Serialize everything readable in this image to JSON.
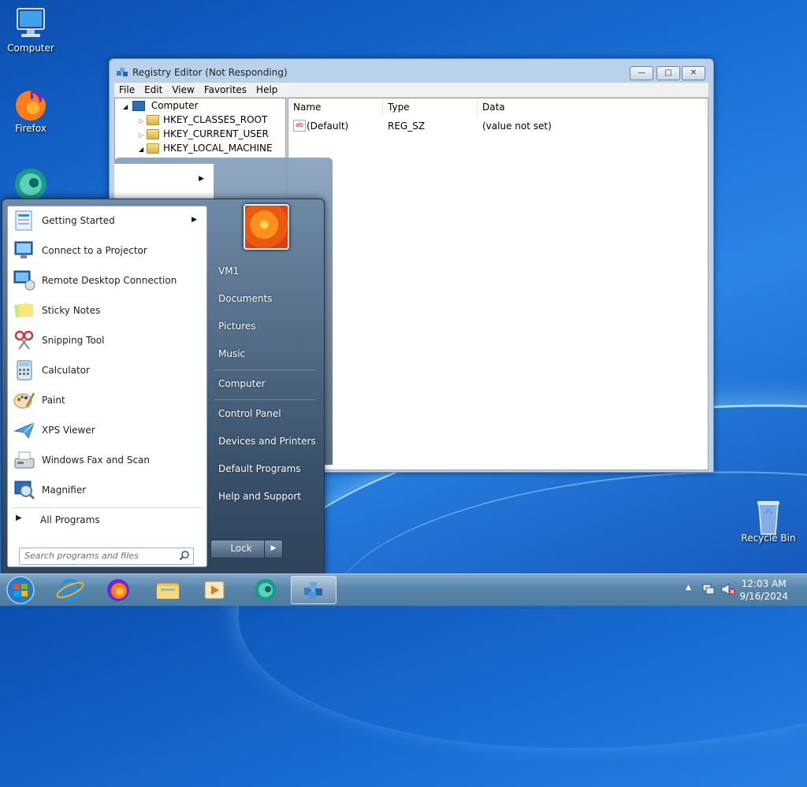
{
  "desktop": {
    "icons": [
      {
        "label": "Computer"
      },
      {
        "label": "Firefox"
      },
      {
        "label": "Recycle Bin"
      }
    ]
  },
  "registry": {
    "title": "Registry Editor (Not Responding)",
    "menu": [
      "File",
      "Edit",
      "View",
      "Favorites",
      "Help"
    ],
    "tree": [
      "Computer",
      "HKEY_CLASSES_ROOT",
      "HKEY_CURRENT_USER",
      "HKEY_LOCAL_MACHINE"
    ],
    "columns": [
      "Name",
      "Type",
      "Data"
    ],
    "rows": [
      {
        "name": "(Default)",
        "type": "REG_SZ",
        "data": "(value not set)"
      }
    ]
  },
  "start_menu": {
    "programs": [
      {
        "label": "Getting Started",
        "icon": "getting-started-icon"
      },
      {
        "label": "Connect to a Projector",
        "icon": "projector-icon"
      },
      {
        "label": "Remote Desktop Connection",
        "icon": "remote-desktop-icon"
      },
      {
        "label": "Sticky Notes",
        "icon": "sticky-notes-icon"
      },
      {
        "label": "Snipping Tool",
        "icon": "snipping-tool-icon"
      },
      {
        "label": "Calculator",
        "icon": "calculator-icon"
      },
      {
        "label": "Paint",
        "icon": "paint-icon"
      },
      {
        "label": "XPS Viewer",
        "icon": "xps-viewer-icon"
      },
      {
        "label": "Windows Fax and Scan",
        "icon": "fax-scan-icon"
      },
      {
        "label": "Magnifier",
        "icon": "magnifier-icon"
      }
    ],
    "all_programs": "All Programs",
    "search_placeholder": "Search programs and files",
    "right_items": [
      "VM1",
      "Documents",
      "Pictures",
      "Music",
      "Computer",
      "Control Panel",
      "Devices and Printers",
      "Default Programs",
      "Help and Support"
    ],
    "lock_label": "Lock"
  },
  "taskbar": {
    "time": "12:03 AM",
    "date": "9/16/2024"
  }
}
